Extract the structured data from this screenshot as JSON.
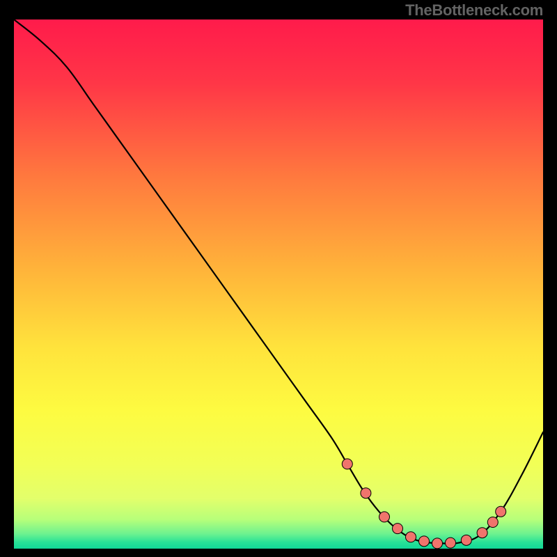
{
  "attribution": "TheBottleneck.com",
  "chart_data": {
    "type": "line",
    "title": "",
    "xlabel": "",
    "ylabel": "",
    "xlim": [
      0,
      100
    ],
    "ylim": [
      0,
      100
    ],
    "grid": false,
    "legend": false,
    "series": [
      {
        "name": "bottleneck-curve",
        "x": [
          0,
          5,
          10,
          15,
          20,
          25,
          30,
          35,
          40,
          45,
          50,
          55,
          60,
          63,
          66,
          69,
          72,
          75,
          78,
          81,
          84,
          88,
          92,
          96,
          100
        ],
        "y": [
          100,
          96,
          91,
          84,
          77,
          70,
          63,
          56,
          49,
          42,
          35,
          28,
          21,
          16,
          11,
          7,
          4,
          2,
          1.2,
          1.0,
          1.1,
          2.5,
          7,
          14,
          22
        ]
      }
    ],
    "markers": {
      "name": "highlight-points",
      "x": [
        63.0,
        66.5,
        70.0,
        72.5,
        75.0,
        77.5,
        80.0,
        82.5,
        85.5,
        88.5,
        90.5,
        92.0
      ],
      "y": [
        16.0,
        10.5,
        6.0,
        3.8,
        2.2,
        1.4,
        1.0,
        1.1,
        1.6,
        3.0,
        5.0,
        7.0
      ]
    },
    "gradient_stops": [
      {
        "offset": 0.0,
        "color": "#ff1b4b"
      },
      {
        "offset": 0.12,
        "color": "#ff3647"
      },
      {
        "offset": 0.3,
        "color": "#ff7a3e"
      },
      {
        "offset": 0.48,
        "color": "#ffb63a"
      },
      {
        "offset": 0.62,
        "color": "#ffe33c"
      },
      {
        "offset": 0.74,
        "color": "#fdfb41"
      },
      {
        "offset": 0.84,
        "color": "#f2ff56"
      },
      {
        "offset": 0.905,
        "color": "#e3ff6b"
      },
      {
        "offset": 0.945,
        "color": "#b7ff7a"
      },
      {
        "offset": 0.972,
        "color": "#6df28f"
      },
      {
        "offset": 0.988,
        "color": "#28e297"
      },
      {
        "offset": 1.0,
        "color": "#11d797"
      }
    ],
    "marker_style": {
      "fill": "#f0746c",
      "stroke": "#000000",
      "r": 7.5
    }
  }
}
